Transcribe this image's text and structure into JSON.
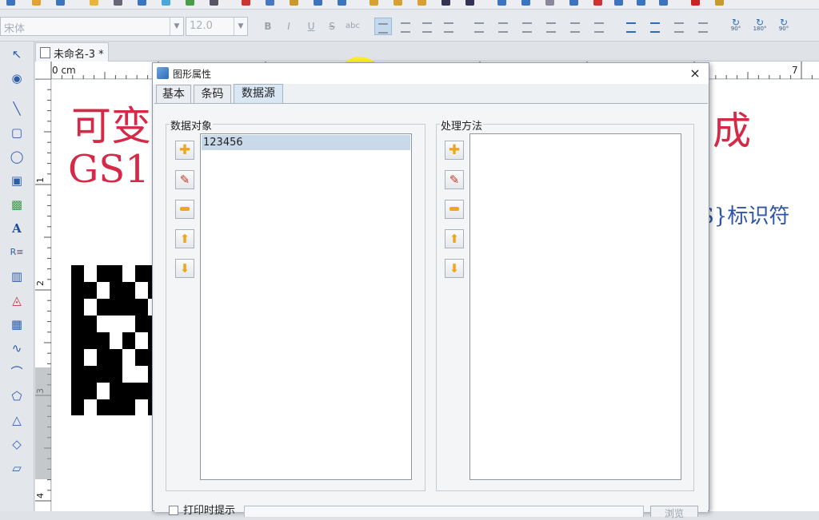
{
  "toolbar": {
    "font_name": "宋体",
    "font_size": "12.0",
    "style_buttons": [
      "B",
      "I",
      "U",
      "S",
      "abc"
    ],
    "rotate_labels": [
      "90°",
      "180°",
      "90°"
    ]
  },
  "document": {
    "tab_label": "未命名-3 *"
  },
  "ruler": {
    "h_origin": "0 cm",
    "h_mark_7": "7",
    "v_marks": [
      "1",
      "2",
      "3",
      "4"
    ]
  },
  "canvas": {
    "red_text_line1_left": "可变",
    "red_text_line1_right": "成",
    "red_text_line2": "GS1",
    "blue_text": "S}标识符"
  },
  "dialog": {
    "title": "图形属性",
    "close_glyph": "×",
    "tabs": [
      {
        "label": "基本"
      },
      {
        "label": "条码"
      },
      {
        "label": "数据源"
      }
    ],
    "data_objects": {
      "label": "数据对象",
      "items": [
        "123456"
      ]
    },
    "processing": {
      "label": "处理方法",
      "items": []
    },
    "bottom": {
      "checkbox_label": "打印时提示",
      "button_label": "浏览"
    }
  },
  "colors": {
    "accent_red": "#d42a48",
    "accent_blue": "#2f55a8",
    "selection": "#c7d9ea",
    "highlight_yellow": "#faee1e"
  }
}
